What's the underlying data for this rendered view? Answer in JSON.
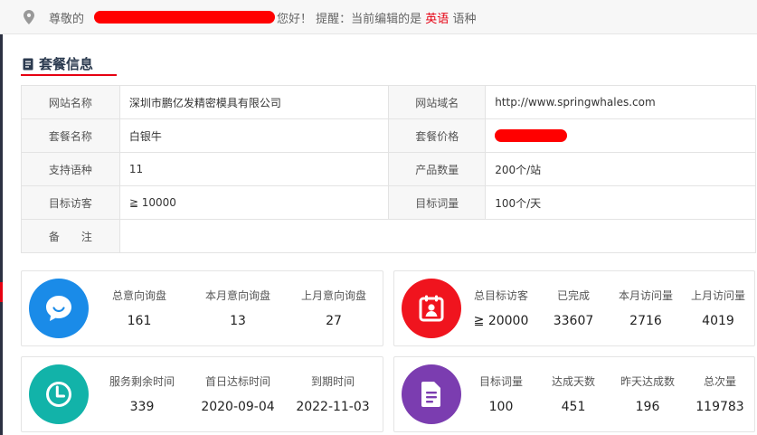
{
  "topbar": {
    "greet": "尊敬的",
    "hello_prefix": "您好！ 提醒：当前编辑的是",
    "lang": "英语",
    "hello_suffix": "语种"
  },
  "section": {
    "title": "套餐信息"
  },
  "info": {
    "site_name_label": "网站名称",
    "site_name": "深圳市鹏亿发精密模具有限公司",
    "domain_label": "网站域名",
    "domain": "http://www.springwhales.com",
    "package_label": "套餐名称",
    "package": "白银牛",
    "price_label": "套餐价格",
    "langs_label": "支持语种",
    "langs": "11",
    "products_label": "产品数量",
    "products": "200个/站",
    "visitors_label": "目标访客",
    "visitors": "≧ 10000",
    "keywords_label": "目标词量",
    "keywords": "100个/天",
    "note_label": "备　　注",
    "note": ""
  },
  "cards": {
    "inquiry": {
      "colors": {
        "icon_bg": "#1a8be8"
      },
      "icon": "chat-bubble-icon",
      "total_label": "总意向询盘",
      "total": "161",
      "month_label": "本月意向询盘",
      "month": "13",
      "last_label": "上月意向询盘",
      "last": "27"
    },
    "visits": {
      "colors": {
        "icon_bg": "#f0141e"
      },
      "icon": "calendar-user-icon",
      "target_label": "总目标访客",
      "target": "≧ 20000",
      "done_label": "已完成",
      "done": "33607",
      "month_label": "本月访问量",
      "month": "2716",
      "last_label": "上月访问量",
      "last": "4019"
    },
    "service": {
      "colors": {
        "icon_bg": "#12b3a9"
      },
      "icon": "clock-icon",
      "remain_label": "服务剩余时间",
      "remain": "339",
      "first_label": "首日达标时间",
      "first": "2020-09-04",
      "expire_label": "到期时间",
      "expire": "2022-11-03"
    },
    "keywords": {
      "colors": {
        "icon_bg": "#7b3db0"
      },
      "icon": "document-icon",
      "target_label": "目标词量",
      "target": "100",
      "days_label": "达成天数",
      "days": "451",
      "yesterday_label": "昨天达成数",
      "yesterday": "196",
      "total_label": "总次量",
      "total": "119783"
    }
  }
}
